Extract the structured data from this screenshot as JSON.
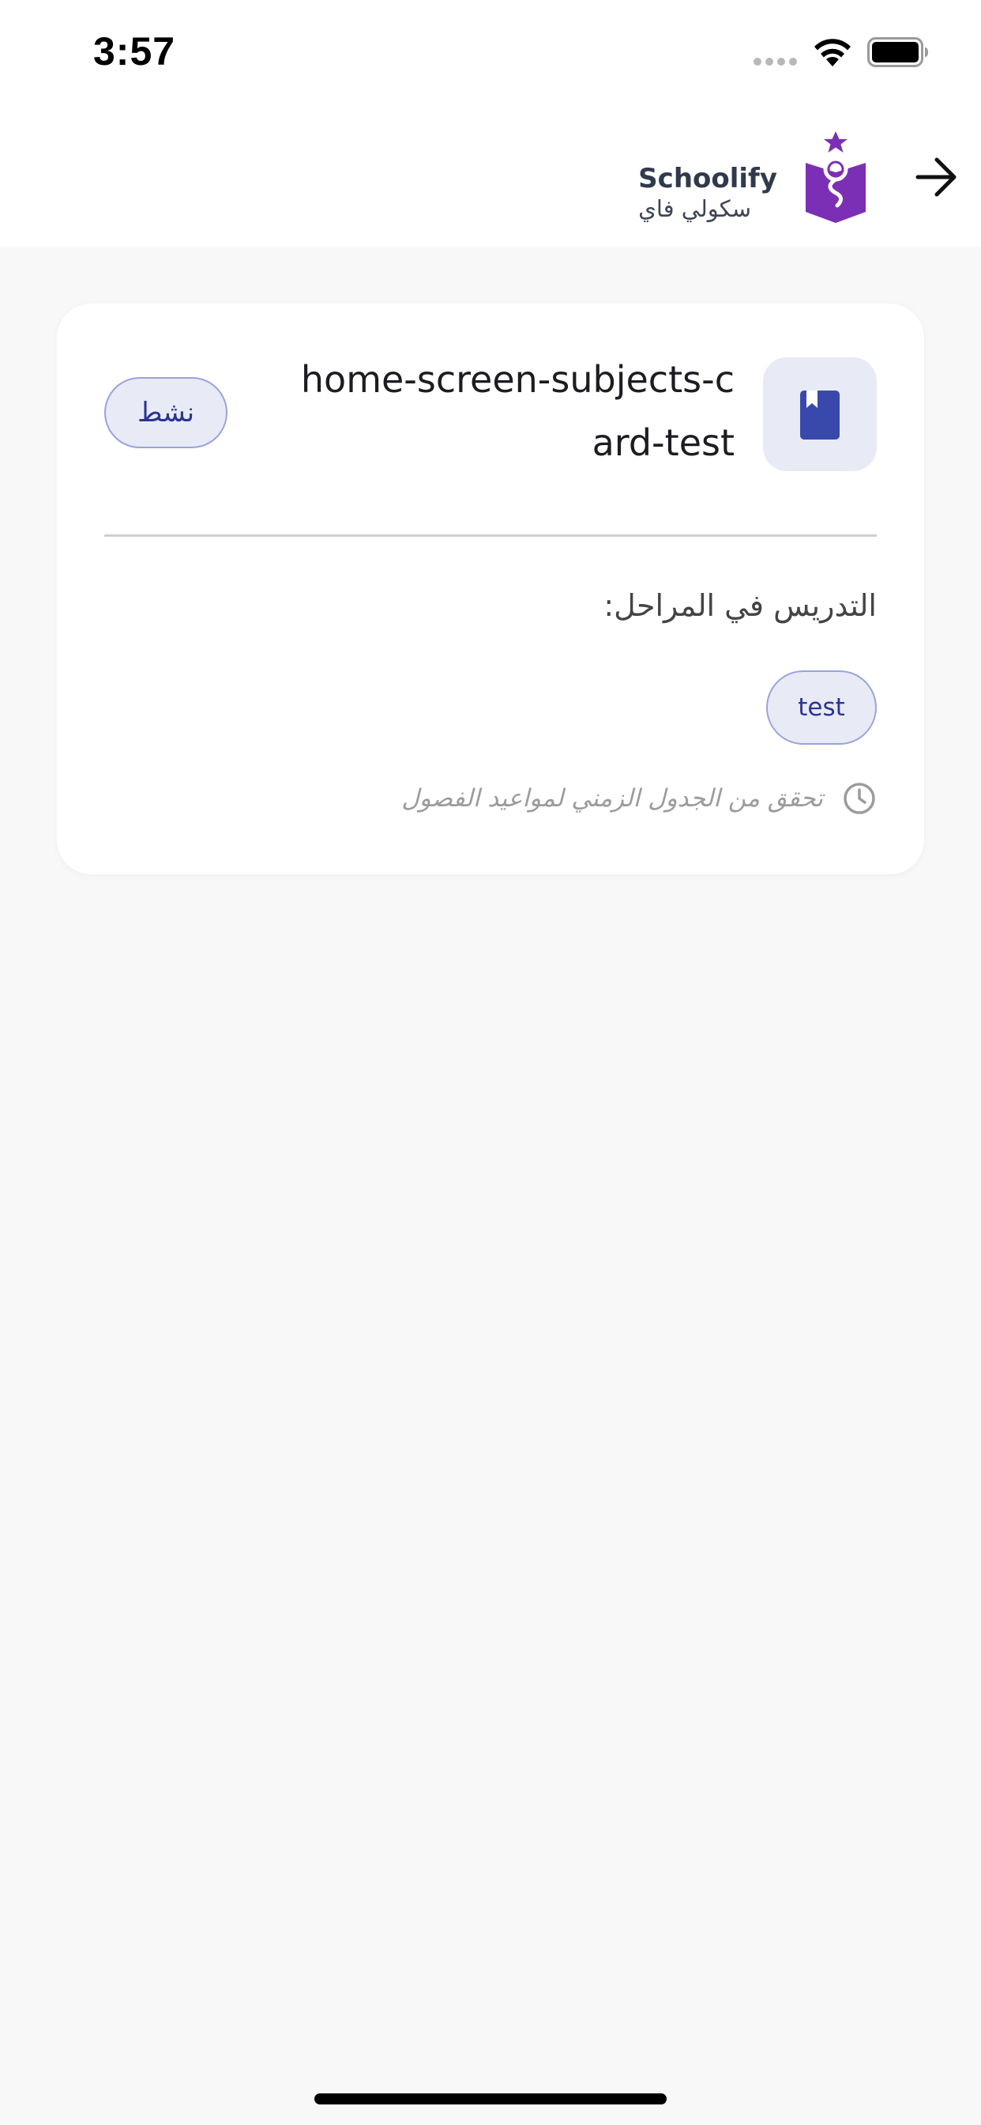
{
  "status_bar": {
    "time": "3:57"
  },
  "header": {
    "brand_name_en": "Schoolify",
    "brand_name_ar": "سكولي فاي",
    "logo_color": "#7b2fb5",
    "back_icon": "arrow-right-icon"
  },
  "subject_card": {
    "icon": "book-icon",
    "icon_color": "#3949ab",
    "title": "home-screen-subjects-card-test",
    "status_badge": "نشط",
    "stages_label": "التدريس في المراحل:",
    "stages": [
      "test"
    ],
    "schedule_hint": "تحقق من الجدول الزمني لمواعيد الفصول",
    "schedule_icon": "clock-icon"
  },
  "colors": {
    "accent": "#3949ab",
    "chip_bg": "#e8eaf6",
    "chip_border": "#9aa3dc",
    "page_bg": "#f8f8f8"
  }
}
